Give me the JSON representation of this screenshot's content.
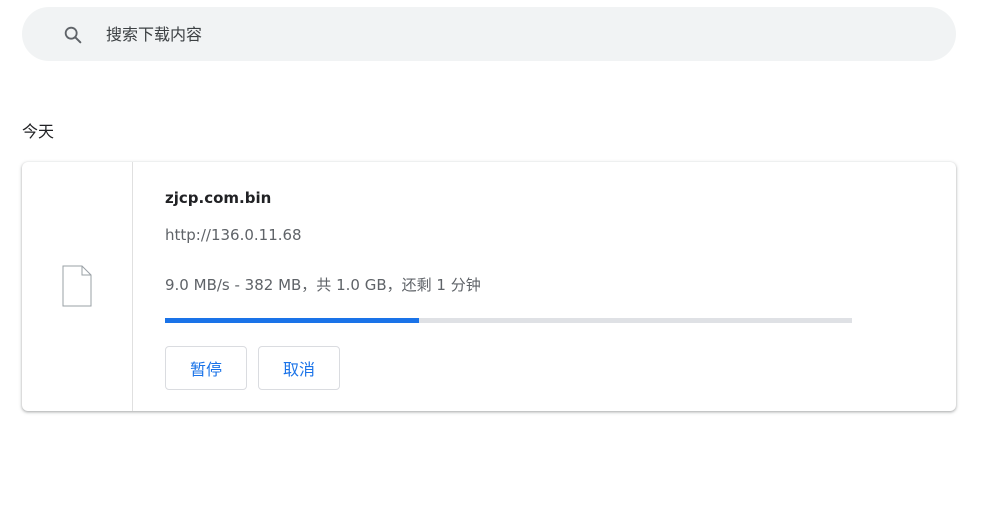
{
  "search": {
    "placeholder": "搜索下载内容",
    "value": ""
  },
  "section": {
    "label": "今天"
  },
  "download": {
    "file_name": "zjcp.com.bin",
    "url": "http://136.0.11.68",
    "status": "9.0 MB/s - 382 MB，共 1.0 GB，还剩 1 分钟",
    "progress_percent": 37,
    "pause_label": "暂停",
    "cancel_label": "取消"
  },
  "colors": {
    "accent": "#1a73e8",
    "track": "#dfe1e5",
    "search_bg": "#f1f3f4"
  },
  "icons": {
    "search": "search-icon",
    "file": "file-icon"
  }
}
